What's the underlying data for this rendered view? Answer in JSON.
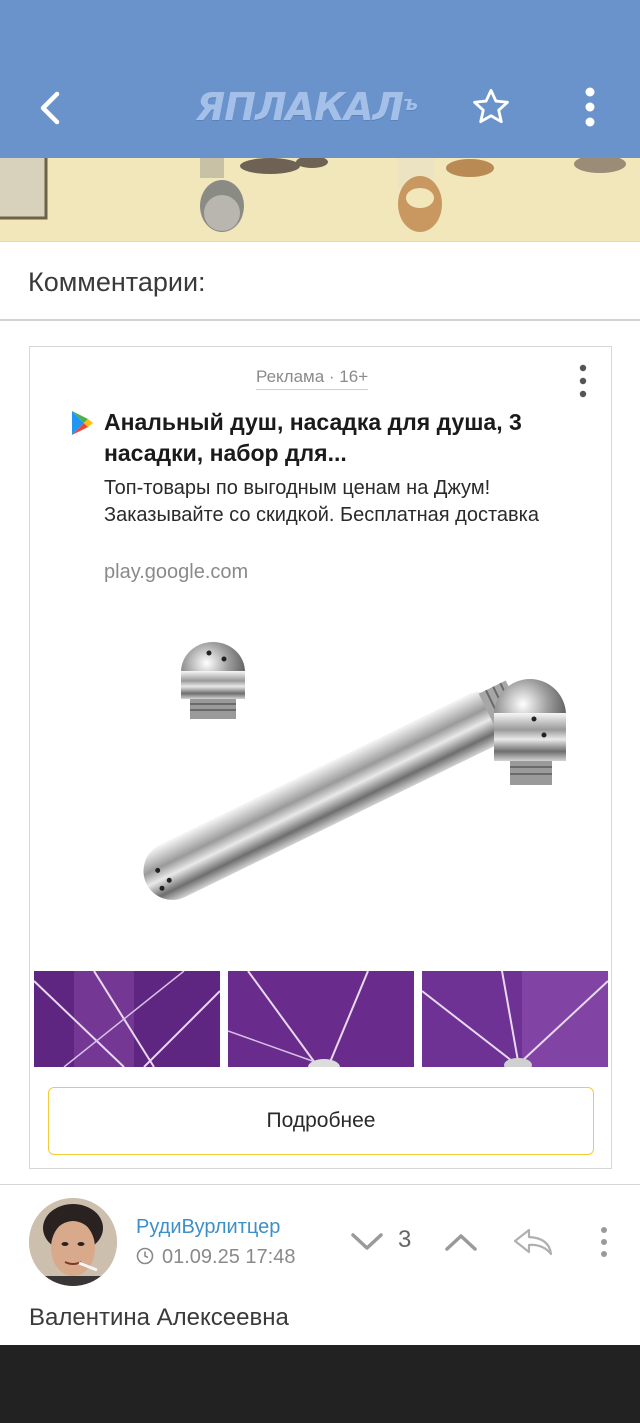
{
  "header": {
    "title": "ЯПЛАКАЛ",
    "title_suffix": "ъ",
    "back_icon": "chevron-left-icon",
    "favorite_icon": "star-outline-icon",
    "menu_icon": "vertical-dots-icon"
  },
  "comments": {
    "heading": "Комментарии:"
  },
  "ad": {
    "label": "Реклама · 16+",
    "title": "Анальный душ, насадка для душа, 3 насадки, набор для...",
    "description": "Топ-товары по выгодным ценам на Джум! Заказывайте со скидкой. Бесплатная доставка",
    "domain": "play.google.com",
    "cta": "Подробнее"
  },
  "comment": {
    "username": "РудиВурлитцер",
    "timestamp": "01.09.25 17:48",
    "score": "3",
    "text": "Валентина Алексеевна"
  },
  "colors": {
    "header_bg": "#6a93cc",
    "username": "#3f8fc7",
    "cta_border": "#f2cc3a"
  }
}
